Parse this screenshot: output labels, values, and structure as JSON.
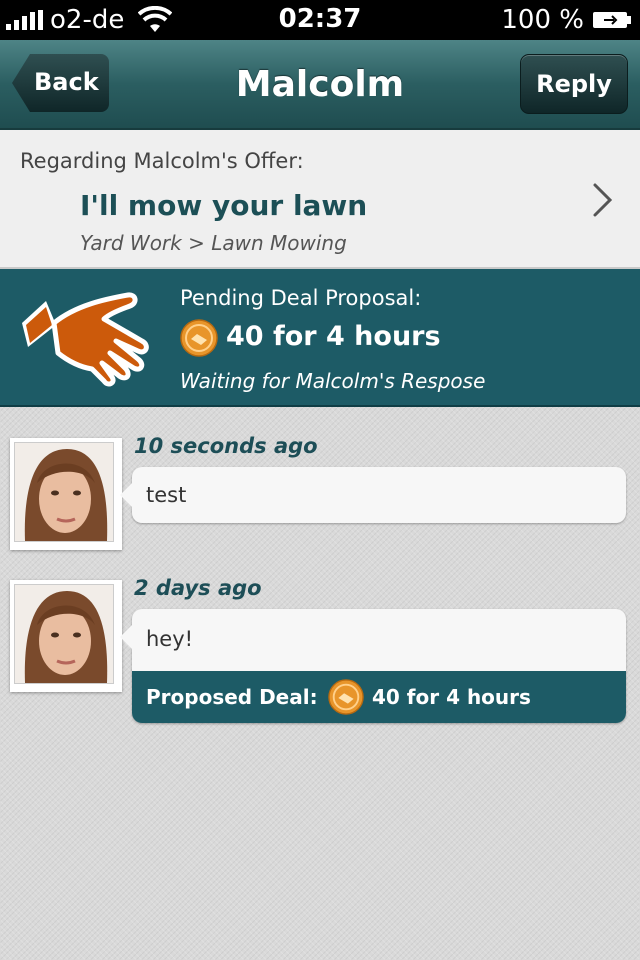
{
  "status_bar": {
    "carrier": "o2-de",
    "time": "02:37",
    "battery": "100 %"
  },
  "nav": {
    "back_label": "Back",
    "title": "Malcolm",
    "reply_label": "Reply"
  },
  "offer": {
    "regarding": "Regarding Malcolm's Offer:",
    "title": "I'll mow your lawn",
    "category": "Yard Work > Lawn Mowing"
  },
  "pending": {
    "label": "Pending Deal Proposal:",
    "amount": "40 for 4 hours",
    "status": "Waiting for Malcolm's Respose"
  },
  "messages": [
    {
      "time": "10 seconds ago",
      "text": "test"
    },
    {
      "time": "2 days ago",
      "text": "hey!",
      "deal_label": "Proposed Deal:",
      "deal_amount": "40 for 4 hours"
    }
  ],
  "colors": {
    "nav": "#2b5e61",
    "teal": "#1d5b66",
    "coin": "#e8952a",
    "hand": "#cc5a0b"
  }
}
